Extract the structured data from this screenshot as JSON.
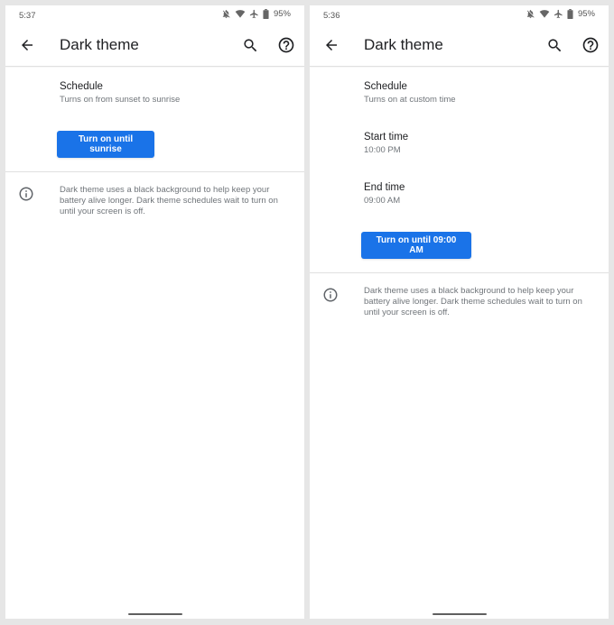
{
  "screens": [
    {
      "status_bar": {
        "time": "5:37",
        "icons": [
          "notifications-off-icon",
          "wifi-icon",
          "airplane-mode-icon",
          "battery-icon"
        ],
        "battery": "95%"
      },
      "app_bar": {
        "back_icon": "arrow-back-icon",
        "title": "Dark theme",
        "search_icon": "search-icon",
        "help_icon": "help-icon"
      },
      "preferences": [
        {
          "title": "Schedule",
          "summary": "Turns on from sunset to sunrise"
        }
      ],
      "action_button": {
        "label": "Turn on until sunrise"
      },
      "footer_info": {
        "icon": "info-icon",
        "text": "Dark theme uses a black background to help keep your battery alive longer. Dark theme schedules wait to turn on until your screen is off."
      }
    },
    {
      "status_bar": {
        "time": "5:36",
        "icons": [
          "notifications-off-icon",
          "wifi-icon",
          "airplane-mode-icon",
          "battery-icon"
        ],
        "battery": "95%"
      },
      "app_bar": {
        "back_icon": "arrow-back-icon",
        "title": "Dark theme",
        "search_icon": "search-icon",
        "help_icon": "help-icon"
      },
      "preferences": [
        {
          "title": "Schedule",
          "summary": "Turns on at custom time"
        },
        {
          "title": "Start time",
          "summary": "10:00 PM"
        },
        {
          "title": "End time",
          "summary": "09:00 AM"
        }
      ],
      "action_button": {
        "label": "Turn on until 09:00 AM"
      },
      "footer_info": {
        "icon": "info-icon",
        "text": "Dark theme uses a black background to help keep your battery alive longer. Dark theme schedules wait to turn on until your screen is off."
      }
    }
  ],
  "colors": {
    "accent": "#1a73e8",
    "background": "#e6e6e6",
    "surface": "#ffffff",
    "text_primary": "#202124",
    "text_secondary": "#70757a"
  }
}
